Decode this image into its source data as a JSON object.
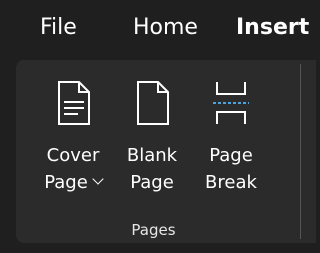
{
  "menubar": {
    "tabs": [
      {
        "label": "File"
      },
      {
        "label": "Home"
      },
      {
        "label": "Insert"
      }
    ]
  },
  "ribbon": {
    "group_label": "Pages",
    "commands": {
      "cover_page": {
        "line1": "Cover",
        "line2": "Page",
        "icon": "cover-page-icon",
        "has_dropdown": true
      },
      "blank_page": {
        "line1": "Blank",
        "line2": "Page",
        "icon": "blank-page-icon"
      },
      "page_break": {
        "line1": "Page",
        "line2": "Break",
        "icon": "page-break-icon"
      }
    }
  },
  "colors": {
    "background": "#1f1f1f",
    "ribbon": "#2b2b2b",
    "text": "#ffffff",
    "accent_dashed": "#4aa3df"
  }
}
